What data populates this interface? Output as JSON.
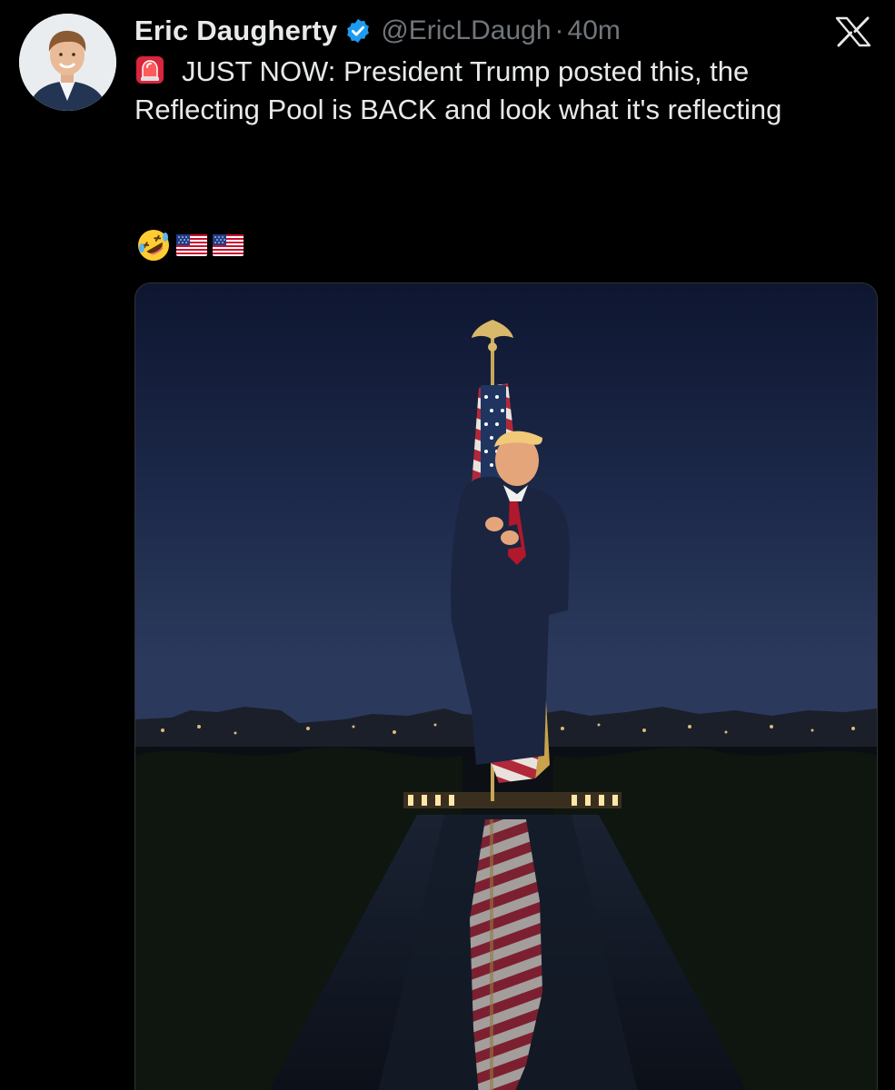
{
  "author": {
    "name": "Eric Daugherty",
    "handle": "@EricLDaugh",
    "separator": "·",
    "time": "40m",
    "verified": true,
    "verified_color": "#1d9bf0",
    "avatar_icon": "avatar-photo"
  },
  "tweet": {
    "line_icon": "siren-icon",
    "text": "JUST NOW: President Trump posted this, the Reflecting Pool is BACK and look what it's reflecting",
    "emoji_icons": [
      "rolling-on-floor-laughing-icon",
      "us-flag-icon",
      "us-flag-icon"
    ]
  },
  "media": {
    "kind": "photo",
    "subject": "flag-hug-reflecting-pool-image"
  },
  "platform_logo": "x-logo-icon",
  "colors": {
    "background": "#000000",
    "text": "#e7e9ea",
    "muted": "#71767b",
    "border": "#2f3336"
  }
}
